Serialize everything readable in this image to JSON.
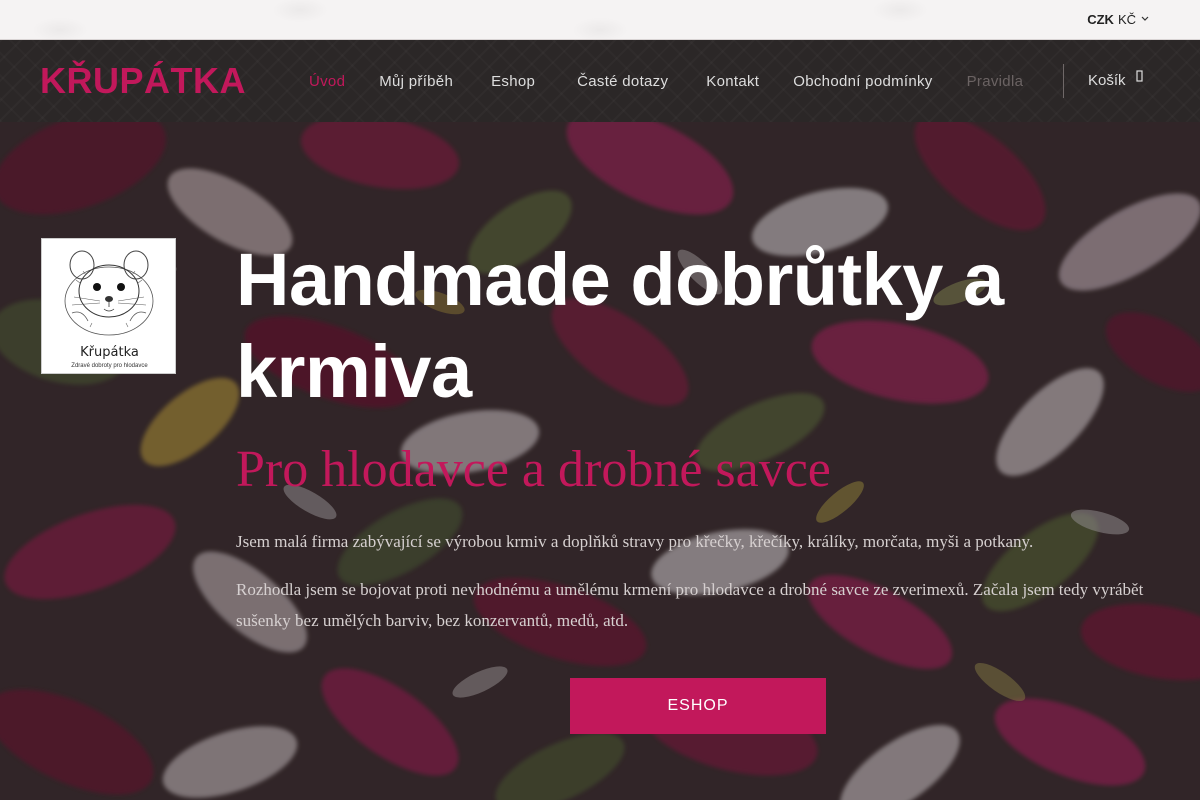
{
  "topbar": {
    "currency_code": "CZK",
    "currency_symbol": "KČ"
  },
  "header": {
    "logo": "KŘUPÁTKA",
    "nav": [
      {
        "label": "Úvod",
        "active": true
      },
      {
        "label": "Můj příběh"
      },
      {
        "label": "Eshop"
      },
      {
        "label": "Časté dotazy"
      },
      {
        "label": "Kontakt"
      },
      {
        "label": "Obchodní podmínky"
      },
      {
        "label": "Pravidla"
      }
    ],
    "cart_label": "Košík"
  },
  "hero": {
    "badge_title": "Křupátka",
    "badge_subtitle": "Zdravé dobroty pro hlodavce",
    "headline": "Handmade dobrůtky a krmiva",
    "subheadline": "Pro hlodavce a drobné savce",
    "paragraph1": "Jsem malá firma zabývající se výrobou krmiv a doplňků stravy pro křečky, křečíky, králíky, morčata, myši a potkany.",
    "paragraph2": "Rozhodla jsem se bojovat proti nevhodnému a umělému krmení pro hlodavce a drobné savce ze zverimexů. Začala jsem tedy vyrábět sušenky bez umělých barviv, bez konzervantů, medů, atd.",
    "cta_label": "ESHOP"
  },
  "colors": {
    "accent": "#c2185b",
    "nav_bg": "#2b2727",
    "topbar_bg": "#f5f3f3"
  },
  "icons": {
    "currency_dropdown": "chevron-down-icon",
    "cart": "cart-icon"
  }
}
